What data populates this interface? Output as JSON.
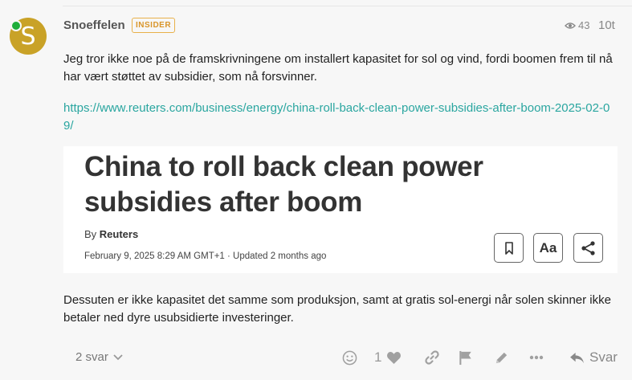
{
  "post": {
    "avatar_letter": "S",
    "username": "Snoeffelen",
    "badge": "INSIDER",
    "views": "43",
    "time": "10t",
    "paragraph1": "Jeg tror ikke noe på de framskrivningene om installert kapasitet for sol og vind, fordi boomen frem til nå har vært støttet av subsidier, som nå forsvinner.",
    "link": "https://www.reuters.com/business/energy/china-roll-back-clean-power-subsidies-after-boom-2025-02-09/",
    "paragraph2": "Dessuten er ikke kapasitet det samme som produksjon, samt at gratis sol-energi når solen skinner ikke betaler ned dyre usubsidierte investeringer."
  },
  "card": {
    "title": "China to roll back clean power subsidies after boom",
    "by_prefix": "By",
    "author": "Reuters",
    "dateline": "February 9, 2025 8:29 AM GMT+1 · Updated 2 months ago",
    "font_button": "Aa"
  },
  "footer": {
    "replies": "2 svar",
    "likes": "1",
    "reply_label": "Svar"
  },
  "colors": {
    "accent_link": "#2aa6a0",
    "badge": "#d9952a",
    "avatar": "#c9a227",
    "online": "#1fae39"
  },
  "icons": [
    "eye-icon",
    "bookmark-icon",
    "share-icon",
    "chevron-down-icon",
    "smile-icon",
    "heart-icon",
    "link-icon",
    "flag-icon",
    "pencil-icon",
    "more-icon",
    "reply-icon"
  ]
}
